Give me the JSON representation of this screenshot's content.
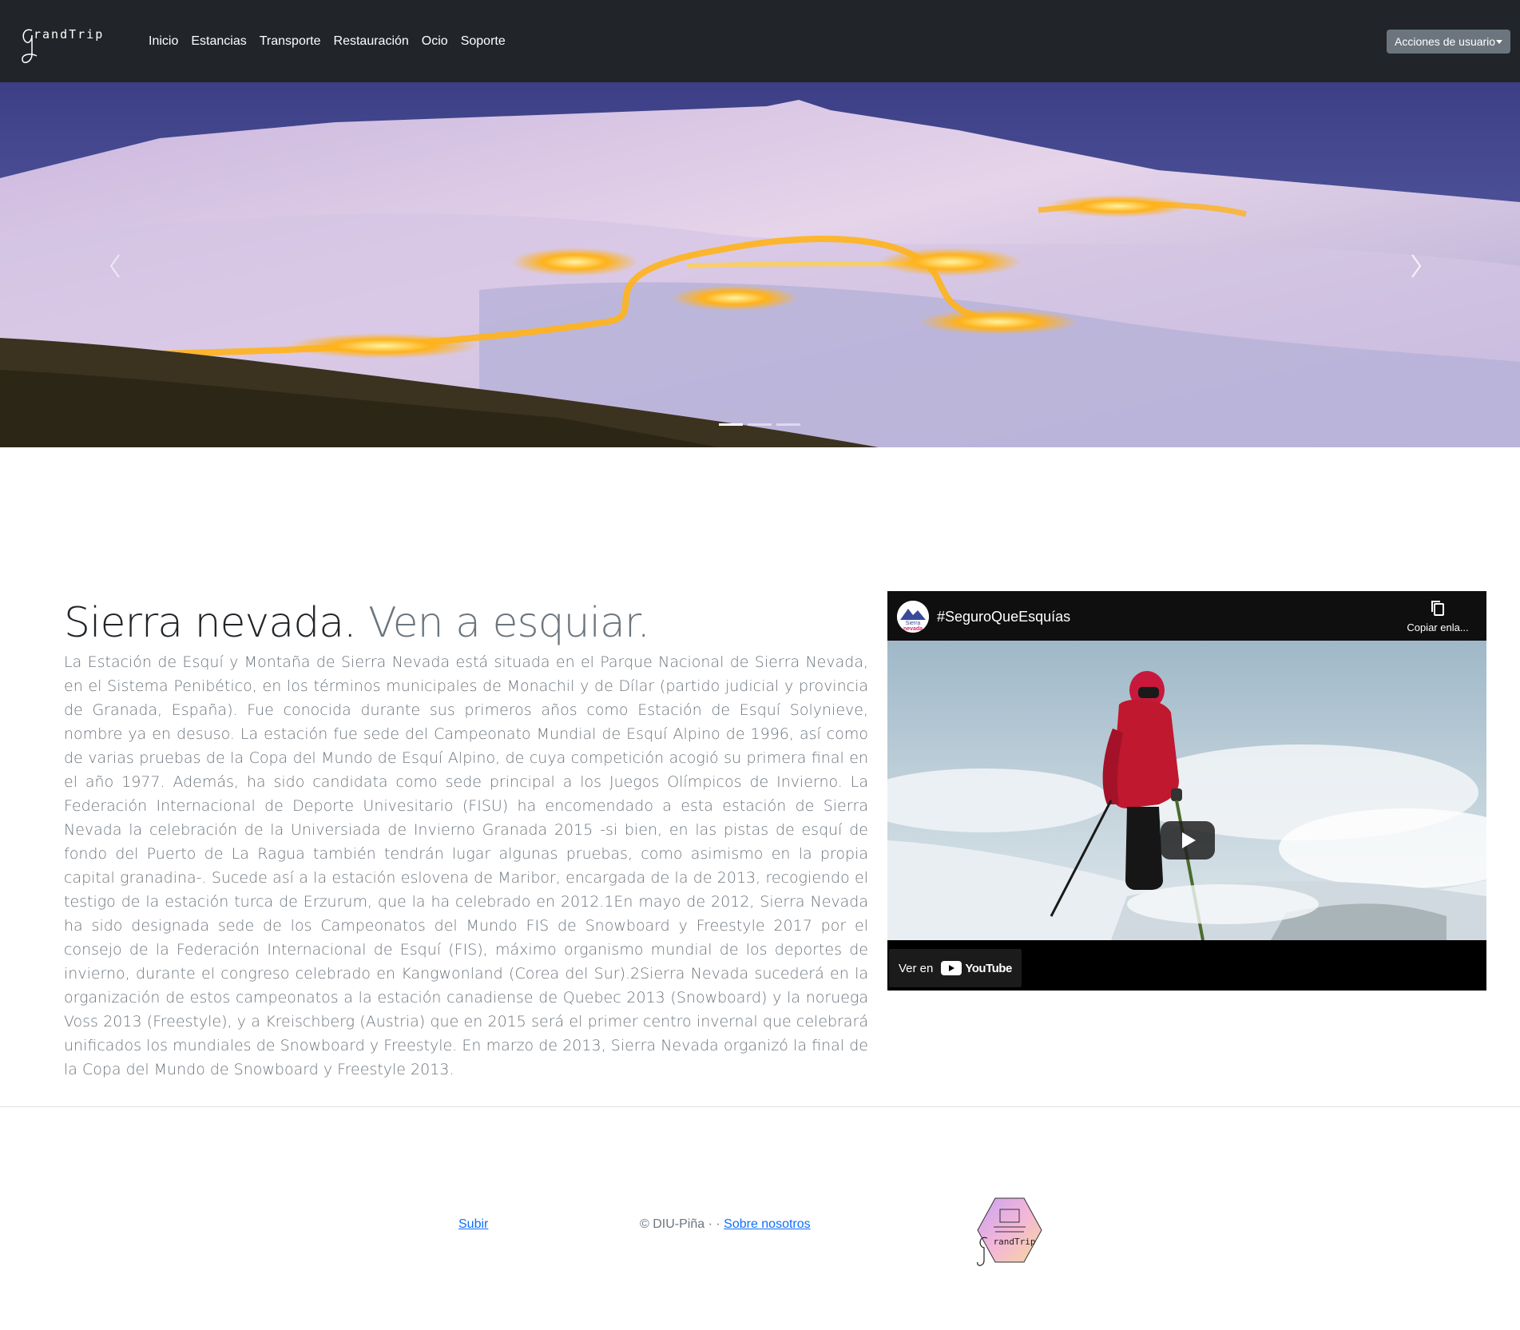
{
  "navbar": {
    "brand": "randTrip",
    "links": [
      "Inicio",
      "Estancias",
      "Transporte",
      "Restauración",
      "Ocio",
      "Soporte"
    ],
    "user_menu": "Acciones de usuario"
  },
  "carousel": {
    "slides": 3,
    "active_slide": 1
  },
  "main": {
    "title": "Sierra nevada.",
    "title_muted": "Ven a esquiar.",
    "body": "La Estación de Esquí y Montaña de Sierra Nevada está situada en el Parque Nacional de Sierra Nevada, en el Sistema Penibético, en los términos municipales de Monachil y de Dílar (partido judicial y provincia de Granada, España). Fue conocida durante sus primeros años como Estación de Esquí Solynieve, nombre ya en desuso. La estación fue sede del Campeonato Mundial de Esquí Alpino de 1996, así como de varias pruebas de la Copa del Mundo de Esquí Alpino, de cuya competición acogió su primera final en el año 1977. Además, ha sido candidata como sede principal a los Juegos Olímpicos de Invierno. La Federación Internacional de Deporte Univesitario (FISU) ha encomendado a esta estación de Sierra Nevada la celebración de la Universiada de Invierno Granada 2015 -si bien, en las pistas de esquí de fondo del Puerto de La Ragua también tendrán lugar algunas pruebas, como asimismo en la propia capital granadina-. Sucede así a la estación eslovena de Maribor, encargada de la de 2013, recogiendo el testigo de la estación turca de Erzurum, que la ha celebrado en 2012.1En mayo de 2012, Sierra Nevada ha sido designada sede de los Campeonatos del Mundo FIS de Snowboard y Freestyle 2017 por el consejo de la Federación Internacional de Esquí (FIS), máximo organismo mundial de los deportes de invierno, durante el congreso celebrado en Kangwonland (Corea del Sur).2Sierra Nevada sucederá en la organización de estos campeonatos a la estación canadiense de Quebec 2013 (Snowboard) y la noruega Voss 2013 (Freestyle), y a Kreischberg (Austria) que en 2015 será el primer centro invernal que celebrará unificados los mundiales de Snowboard y Freestyle. En marzo de 2013, Sierra Nevada organizó la final de la Copa del Mundo de Snowboard y Freestyle 2013."
  },
  "video": {
    "channel_line1": "Sierra",
    "channel_line2": "nevada",
    "title": "#SeguroQueEsquías",
    "copy_link": "Copiar enla...",
    "watch_on": "Ver en",
    "youtube": "YouTube"
  },
  "footer": {
    "up_link": "Subir",
    "copyright": "© DIU-Piña · ·",
    "about_link": "Sobre nosotros",
    "logo_text": "randTrip"
  },
  "colors": {
    "navbar_bg": "#212529",
    "user_btn_bg": "#6c757d",
    "link": "#0d6efd",
    "muted_text": "#6c757d"
  }
}
